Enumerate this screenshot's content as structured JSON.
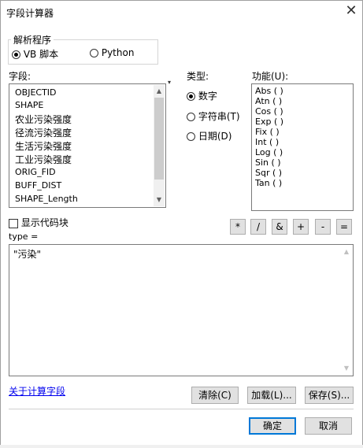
{
  "dialog": {
    "title": "字段计算器"
  },
  "parser": {
    "legend": "解析程序",
    "options": [
      {
        "label": "VB 脚本",
        "selected": true
      },
      {
        "label": "Python",
        "selected": false
      }
    ]
  },
  "fields": {
    "label": "字段:",
    "items": [
      "OBJECTID",
      "SHAPE",
      "农业污染强度",
      "径流污染强度",
      "生活污染强度",
      "工业污染强度",
      "ORIG_FID",
      "BUFF_DIST",
      "SHAPE_Length"
    ]
  },
  "type": {
    "label": "类型:",
    "options": [
      {
        "label": "数字",
        "selected": true
      },
      {
        "label": "字符串(T)",
        "selected": false
      },
      {
        "label": "日期(D)",
        "selected": false
      }
    ]
  },
  "functions": {
    "label": "功能(U):",
    "items": [
      "Abs ( )",
      "Atn ( )",
      "Cos ( )",
      "Exp ( )",
      "Fix ( )",
      "Int ( )",
      "Log ( )",
      "Sin ( )",
      "Sqr ( )",
      "Tan ( )"
    ]
  },
  "codeblock": {
    "label": "显示代码块",
    "checked": false
  },
  "operators": [
    "*",
    "/",
    "&",
    "+",
    "-",
    "="
  ],
  "expression": {
    "label": "type =",
    "value": "\"污染\""
  },
  "actions": {
    "about_link": "关于计算字段",
    "clear": "清除(C)",
    "load": "加载(L)...",
    "save": "保存(S)...",
    "ok": "确定",
    "cancel": "取消"
  }
}
